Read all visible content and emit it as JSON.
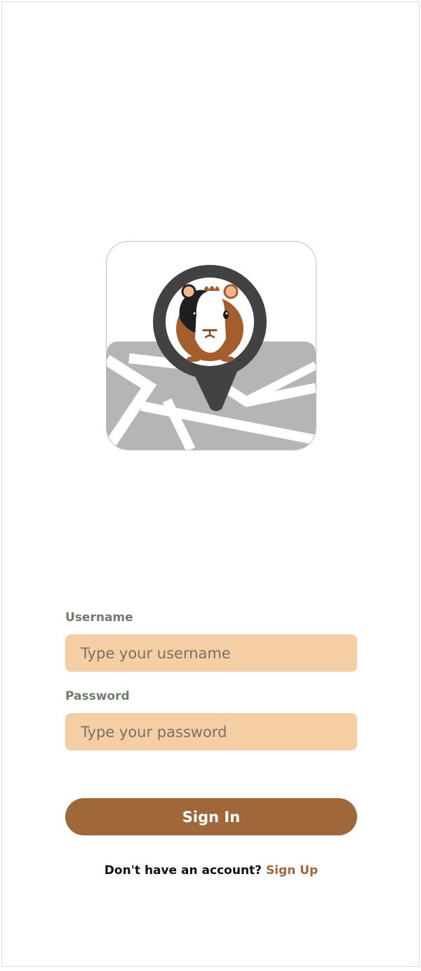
{
  "logo": {
    "name": "guinea-pig-map-pin-logo",
    "colors": {
      "map": "#b5b5b5",
      "roads": "#ffffff",
      "pin": "#424242",
      "fur_brown": "#a45e2d",
      "fur_black": "#1f1f1f",
      "ear": "#f2b58f"
    }
  },
  "form": {
    "username": {
      "label": "Username",
      "placeholder": "Type your username",
      "value": ""
    },
    "password": {
      "label": "Password",
      "placeholder": "Type your password",
      "value": ""
    },
    "submit_label": "Sign In"
  },
  "footer": {
    "prompt": "Don't have an account?",
    "link_label": "Sign Up"
  },
  "colors": {
    "accent": "#a0673b",
    "input_bg": "#f5cea3",
    "label": "#6e7d6c"
  }
}
